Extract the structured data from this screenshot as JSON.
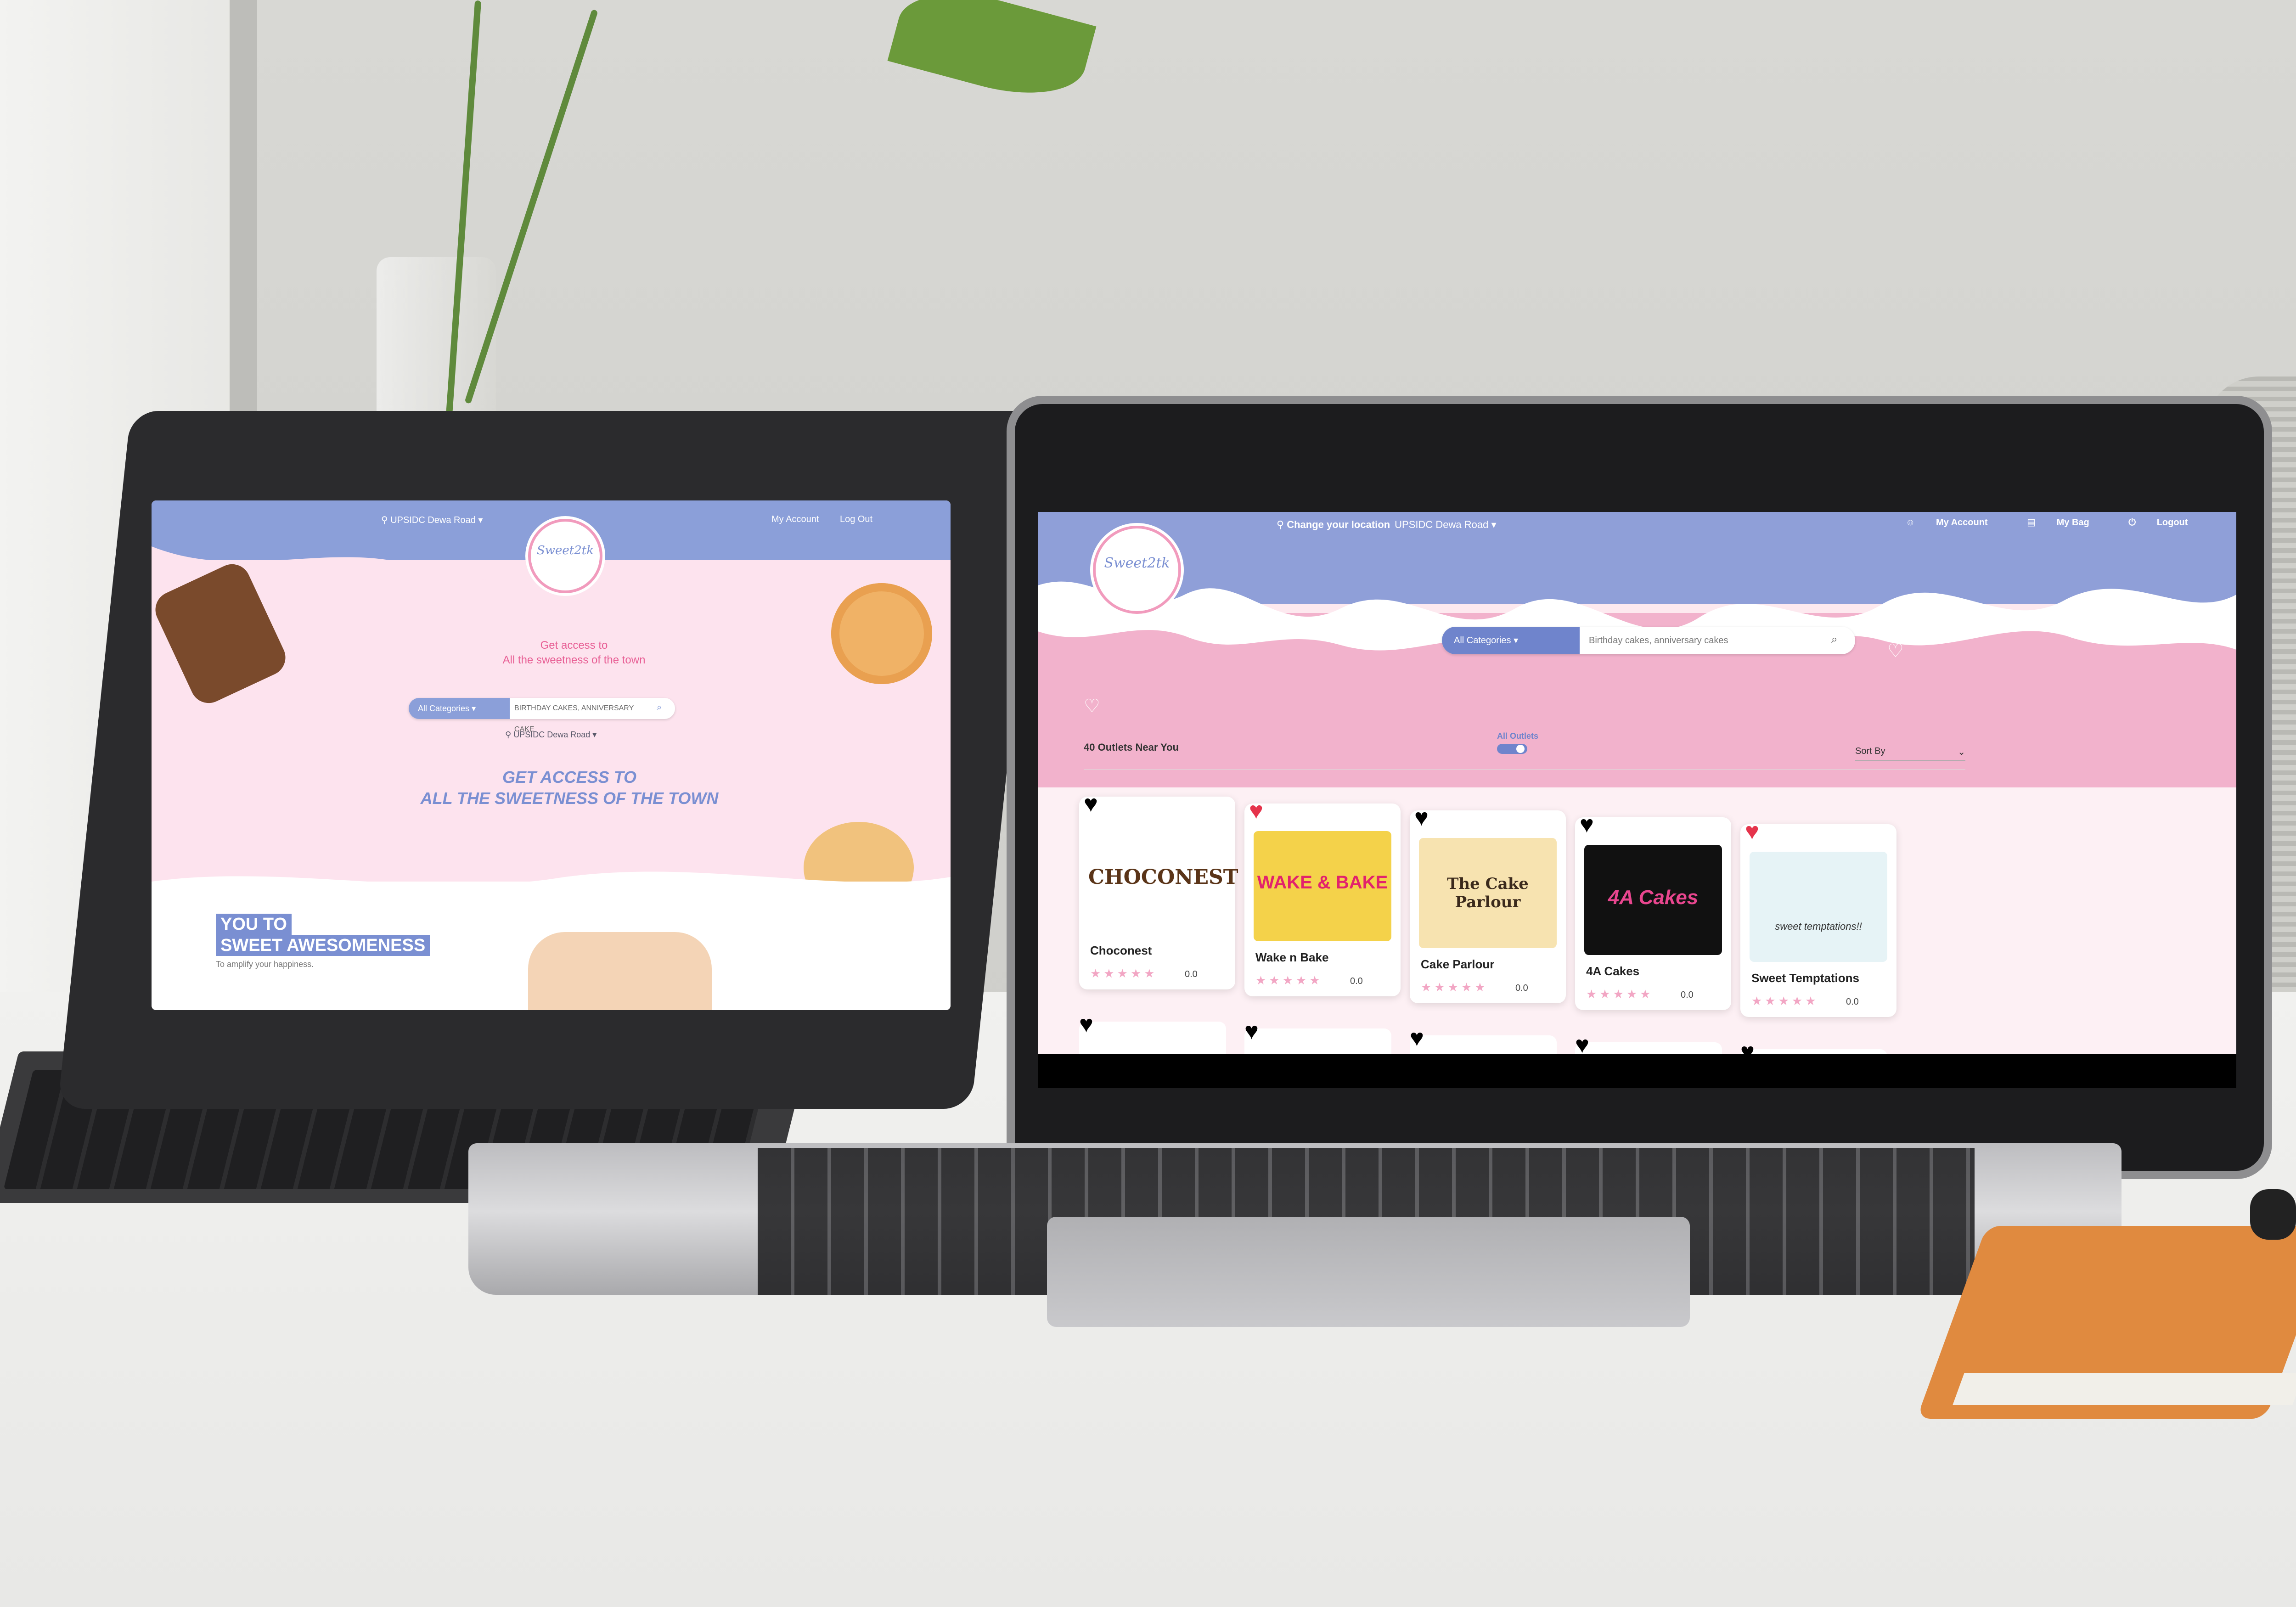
{
  "tablet": {
    "location": "UPSIDC Dewa Road",
    "links": [
      "My Account",
      "Log Out"
    ],
    "logo": "Sweet2tk",
    "access_line1": "Get access to",
    "access_line2": "All the sweetness of the town",
    "search": {
      "category": "All Categories",
      "placeholder": "BIRTHDAY CAKES, ANNIVERSARY CAKE"
    },
    "location2": "UPSIDC Dewa Road",
    "headline_line1": "GET ACCESS TO",
    "headline_line2": "ALL THE SWEETNESS OF THE TOWN",
    "you_to": "YOU TO",
    "sweet_awesomeness": "SWEET AWESOMENESS",
    "amplify": "To amplify your happiness."
  },
  "laptop": {
    "change_location_label": "Change your location",
    "location": "UPSIDC Dewa Road",
    "account_links": [
      "My Account",
      "My Bag",
      "Logout"
    ],
    "logo": "Sweet2tk",
    "search": {
      "category": "All Categories",
      "placeholder": "Birthday cakes, anniversary cakes"
    },
    "outlets_count": "40 Outlets Near You",
    "all_outlets_label": "All Outlets",
    "sort_label": "Sort By",
    "outlets": [
      {
        "name": "Choconest",
        "logo_text": "CHOCONEST",
        "rating": "0.0",
        "favorite": false,
        "logo_bg": "#ffffff",
        "logo_color": "#5a3418"
      },
      {
        "name": "Wake n Bake",
        "logo_text": "WAKE & BAKE",
        "rating": "0.0",
        "favorite": true,
        "logo_bg": "#f4d24a",
        "logo_color": "#e2226c"
      },
      {
        "name": "Cake Parlour",
        "logo_text": "The Cake Parlour",
        "rating": "0.0",
        "favorite": false,
        "logo_bg": "#f7e3b0",
        "logo_color": "#3b2a1c"
      },
      {
        "name": "4A Cakes",
        "logo_text": "4A Cakes",
        "rating": "0.0",
        "favorite": false,
        "logo_bg": "#111111",
        "logo_color": "#e9468f"
      },
      {
        "name": "Sweet Temptations",
        "logo_text": "sweet temptations!!",
        "rating": "0.0",
        "favorite": true,
        "logo_bg": "#e6f3f6",
        "logo_color": "#333333"
      }
    ]
  },
  "colors": {
    "periwinkle": "#8f9fd8",
    "pink": "#f2b2cc",
    "heart_red": "#e5334b"
  }
}
